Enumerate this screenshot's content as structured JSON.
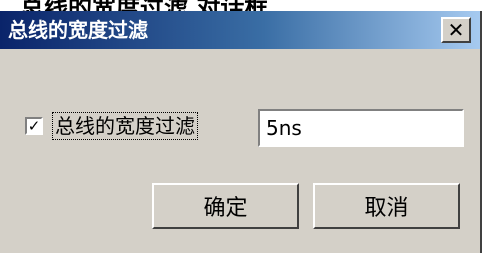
{
  "background_caption": "总线的宽度过滤 对话框",
  "dialog": {
    "title": "总线的宽度过滤",
    "close_glyph": "✕",
    "checkbox": {
      "checked": true,
      "glyph": "✓",
      "label": "总线的宽度过滤"
    },
    "input": {
      "value": "5ns"
    },
    "ok_label": "确定",
    "cancel_label": "取消"
  },
  "colors": {
    "face": "#d4d0c8",
    "title_start": "#0a246a",
    "title_end": "#a6caf0"
  }
}
